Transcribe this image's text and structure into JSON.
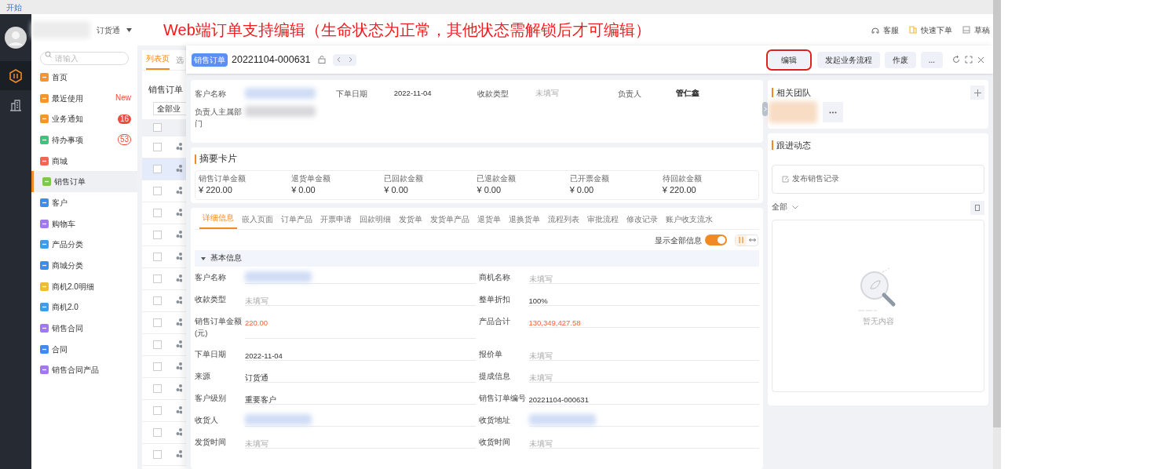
{
  "annotation": "Web端订单支持编辑（生命状态为正常，其他状态需解锁后才可编辑）",
  "top_bar": {
    "link": "开始"
  },
  "header": {
    "app_switch": "订货通",
    "links": [
      "客服",
      "快速下单",
      "草稿"
    ]
  },
  "rail": [
    {
      "selected": true
    },
    {
      "selected": false
    }
  ],
  "nav": {
    "search": {
      "placeholder": "请输入"
    },
    "items": [
      {
        "label": "首页",
        "color": "#f7952c",
        "selected": false
      },
      {
        "label": "最近使用",
        "color": "#f7952c",
        "selected": false,
        "badge": {
          "text": "New",
          "kind": "new"
        }
      },
      {
        "label": "业务通知",
        "color": "#f7952c",
        "selected": false,
        "badge": {
          "text": "16",
          "kind": "filled"
        }
      },
      {
        "label": "待办事项",
        "color": "#3cc47c",
        "selected": false,
        "badge": {
          "text": "53",
          "kind": "outline"
        }
      },
      {
        "label": "商城",
        "color": "#f0674e",
        "selected": false
      },
      {
        "label": "销售订单",
        "color": "#7cc94c",
        "selected": true
      },
      {
        "label": "客户",
        "color": "#3d8cf0",
        "selected": false
      },
      {
        "label": "购物车",
        "color": "#a277f2",
        "selected": false
      },
      {
        "label": "产品分类",
        "color": "#3d9cf0",
        "selected": false
      },
      {
        "label": "商城分类",
        "color": "#3d8cf0",
        "selected": false
      },
      {
        "label": "商机2.0明细",
        "color": "#f5b935",
        "selected": false
      },
      {
        "label": "商机2.0",
        "color": "#3d9cf0",
        "selected": false
      },
      {
        "label": "销售合同",
        "color": "#a277f2",
        "selected": false
      },
      {
        "label": "合同",
        "color": "#3d8cf0",
        "selected": false
      },
      {
        "label": "销售合同产品",
        "color": "#a277f2",
        "selected": false
      }
    ]
  },
  "list_panel": {
    "tabs": [
      {
        "label": "列表页",
        "selected": true
      },
      {
        "label": "选",
        "selected": false
      }
    ],
    "title": "销售订单",
    "filter": "全部业",
    "header_checked": false,
    "rows": [
      {
        "selected": false
      },
      {
        "selected": true
      },
      {
        "selected": false
      },
      {
        "selected": false
      },
      {
        "selected": false
      },
      {
        "selected": false
      },
      {
        "selected": false
      },
      {
        "selected": false
      },
      {
        "selected": false
      },
      {
        "selected": false
      },
      {
        "selected": false
      },
      {
        "selected": false
      },
      {
        "selected": false
      },
      {
        "selected": false
      },
      {
        "selected": false
      }
    ]
  },
  "detail": {
    "tag": "销售订单",
    "number": "20221104-000631",
    "buttons": [
      {
        "label": "编辑",
        "highlighted": true
      },
      {
        "label": "发起业务流程",
        "highlighted": false
      },
      {
        "label": "作废",
        "highlighted": false
      },
      {
        "label": "...",
        "highlighted": false
      }
    ],
    "summary_fields": [
      {
        "label": "客户名称",
        "kind": "blurred"
      },
      {
        "label": "下单日期",
        "value": "2022-11-04",
        "kind": "normal"
      },
      {
        "label": "收款类型",
        "value": "未填写",
        "kind": "empty"
      },
      {
        "label": "负责人",
        "value": "管仁鑫",
        "kind": "bold"
      },
      {
        "label": "负责人主属部门",
        "kind": "blurred"
      }
    ],
    "summary_card": {
      "title": "摘要卡片",
      "metrics": [
        {
          "label": "销售订单金额",
          "value": "¥ 220.00"
        },
        {
          "label": "退货单金额",
          "value": "¥ 0.00"
        },
        {
          "label": "已回款金额",
          "value": "¥ 0.00"
        },
        {
          "label": "已退款金额",
          "value": "¥ 0.00"
        },
        {
          "label": "已开票金额",
          "value": "¥ 0.00"
        },
        {
          "label": "待回款金额",
          "value": "¥ 220.00"
        }
      ]
    },
    "tabs": [
      {
        "label": "详细信息",
        "selected": true
      },
      {
        "label": "嵌入页面",
        "selected": false
      },
      {
        "label": "订单产品",
        "selected": false
      },
      {
        "label": "开票申请",
        "selected": false
      },
      {
        "label": "回款明细",
        "selected": false
      },
      {
        "label": "发货单",
        "selected": false
      },
      {
        "label": "发货单产品",
        "selected": false
      },
      {
        "label": "退货单",
        "selected": false
      },
      {
        "label": "退换货单",
        "selected": false
      },
      {
        "label": "流程列表",
        "selected": false
      },
      {
        "label": "审批流程",
        "selected": false
      },
      {
        "label": "修改记录",
        "selected": false
      },
      {
        "label": "账户收支流水",
        "selected": false
      }
    ],
    "show_all": {
      "label": "显示全部信息",
      "on": true
    },
    "section": {
      "title": "基本信息",
      "expanded": true
    },
    "fields": [
      {
        "label": "客户名称",
        "kind": "blurred"
      },
      {
        "label": "商机名称",
        "value": "未填写",
        "kind": "empty"
      },
      {
        "label": "收款类型",
        "value": "未填写",
        "kind": "empty"
      },
      {
        "label": "整单折扣",
        "value": "100%",
        "kind": "normal"
      },
      {
        "label": "销售订单金额(元)",
        "value": "220.00",
        "kind": "amount"
      },
      {
        "label": "产品合计",
        "value": "130,349,427.58",
        "kind": "amount"
      },
      {
        "label": "下单日期",
        "value": "2022-11-04",
        "kind": "normal"
      },
      {
        "label": "报价单",
        "value": "未填写",
        "kind": "empty"
      },
      {
        "label": "来源",
        "value": "订货通",
        "kind": "normal"
      },
      {
        "label": "提成信息",
        "value": "未填写",
        "kind": "empty"
      },
      {
        "label": "客户级别",
        "value": "重要客户",
        "kind": "normal"
      },
      {
        "label": "销售订单编号",
        "value": "20221104-000631",
        "kind": "normal"
      },
      {
        "label": "收货人",
        "kind": "blurred"
      },
      {
        "label": "收货地址",
        "kind": "blurred"
      },
      {
        "label": "发货时间",
        "value": "未填写",
        "kind": "empty"
      },
      {
        "label": "收货时间",
        "value": "未填写",
        "kind": "empty"
      }
    ]
  },
  "side": {
    "team_title": "相关团队",
    "follow_title": "跟进动态",
    "post": "发布销售记录",
    "filter": "全部",
    "empty": "暂无内容"
  }
}
